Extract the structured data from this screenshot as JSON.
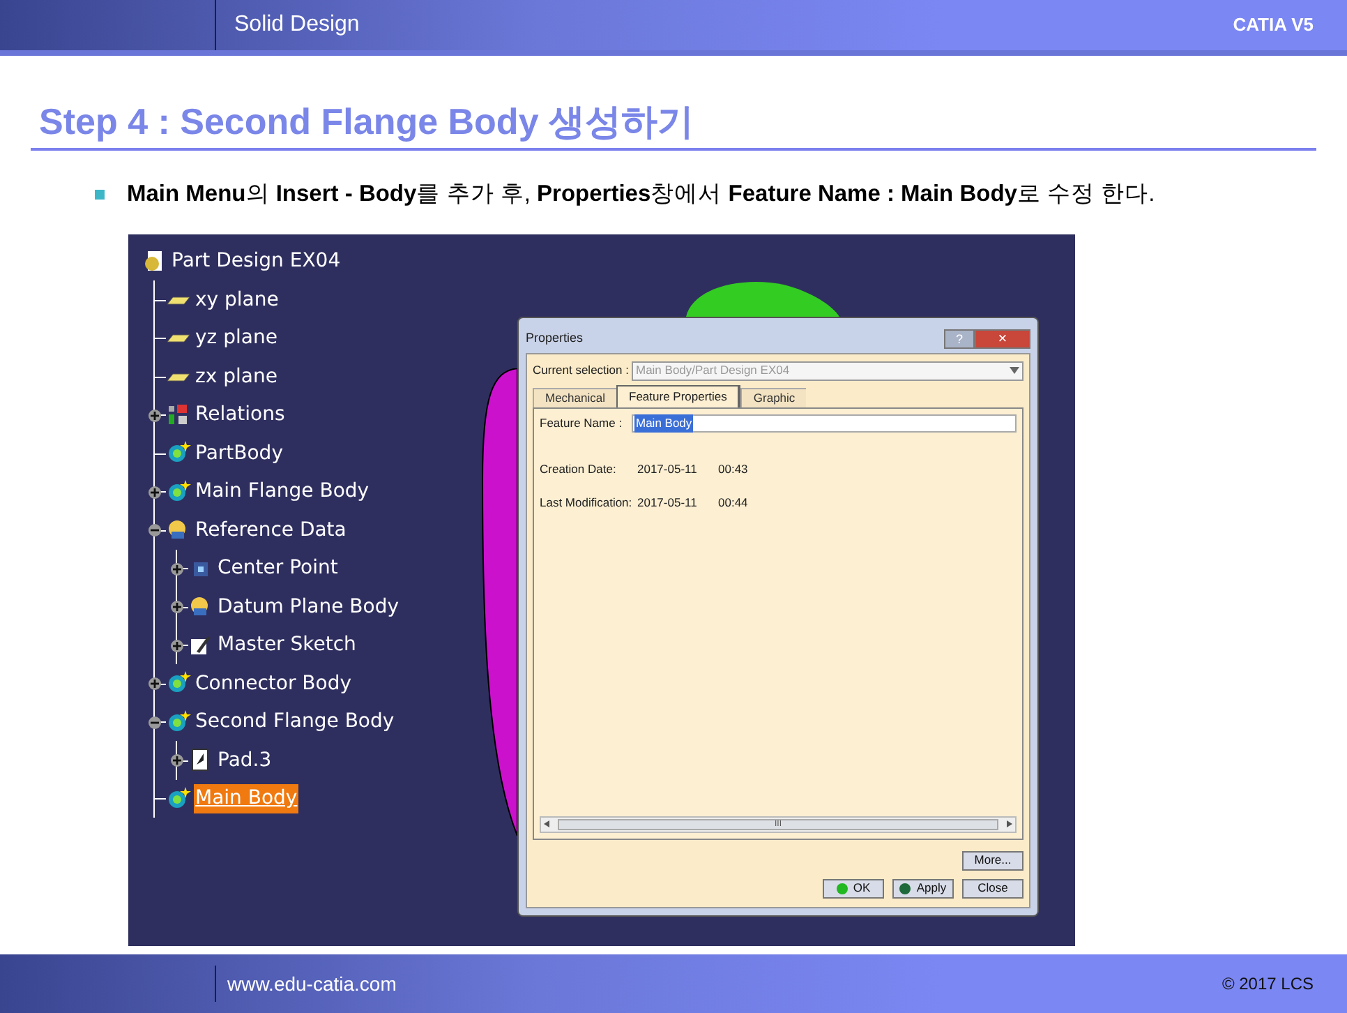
{
  "header": {
    "section": "Solid Design",
    "product": "CATIA V5"
  },
  "title": "Step 4 : Second Flange Body 생성하기",
  "bullet": "**Main Menu**의 **Insert - Body**를 추가 후, **Properties**창에서 **Feature Name : Main Body**로 수정 한다.",
  "tree": {
    "label": "Part Design EX04",
    "kind": "part",
    "selected": false,
    "children": [
      {
        "label": "xy plane",
        "kind": "plane",
        "selected": false
      },
      {
        "label": "yz plane",
        "kind": "plane",
        "selected": false
      },
      {
        "label": "zx plane",
        "kind": "plane",
        "selected": false
      },
      {
        "label": "Relations",
        "kind": "relations",
        "expanded": false,
        "selected": false
      },
      {
        "label": "PartBody",
        "kind": "body",
        "selected": false
      },
      {
        "label": "Main Flange Body",
        "kind": "body",
        "expanded": false,
        "selected": false
      },
      {
        "label": "Reference Data",
        "kind": "geoset",
        "expanded": true,
        "selected": false,
        "children": [
          {
            "label": "Center Point",
            "kind": "point",
            "expanded": false,
            "selected": false
          },
          {
            "label": "Datum Plane Body",
            "kind": "geoset",
            "expanded": false,
            "selected": false
          },
          {
            "label": "Master Sketch",
            "kind": "sketch",
            "expanded": false,
            "selected": false
          }
        ]
      },
      {
        "label": "Connector Body",
        "kind": "body",
        "expanded": false,
        "selected": false
      },
      {
        "label": "Second Flange Body",
        "kind": "body",
        "expanded": true,
        "selected": false,
        "children": [
          {
            "label": "Pad.3",
            "kind": "pad",
            "expanded": false,
            "selected": false
          }
        ]
      },
      {
        "label": "Main Body",
        "kind": "body",
        "selected": true
      }
    ]
  },
  "dialog": {
    "title": "Properties",
    "help_button": "?",
    "close_button": "×",
    "current_selection": {
      "label": "Current selection :",
      "value": "Main Body/Part Design EX04",
      "disabled": true
    },
    "tabs": [
      {
        "label": "Mechanical",
        "selected": false
      },
      {
        "label": "Feature Properties",
        "selected": true
      },
      {
        "label": "Graphic",
        "selected": false
      }
    ],
    "feature_name": {
      "label": "Feature Name :",
      "value": "Main Body"
    },
    "fields": [
      {
        "label": "Creation Date:",
        "date": "2017-05-11",
        "time": "00:43"
      },
      {
        "label": "Last Modification:",
        "date": "2017-05-11",
        "time": "00:44"
      }
    ],
    "scrollbar_grip": "III",
    "buttons": [
      {
        "label": "More...",
        "kind": "plain"
      },
      {
        "label": "OK",
        "kind": "ok"
      },
      {
        "label": "Apply",
        "kind": "apply"
      },
      {
        "label": "Close",
        "kind": "plain"
      }
    ]
  },
  "footer": {
    "url": "www.edu-catia.com",
    "copyright": "© 2017 LCS"
  }
}
